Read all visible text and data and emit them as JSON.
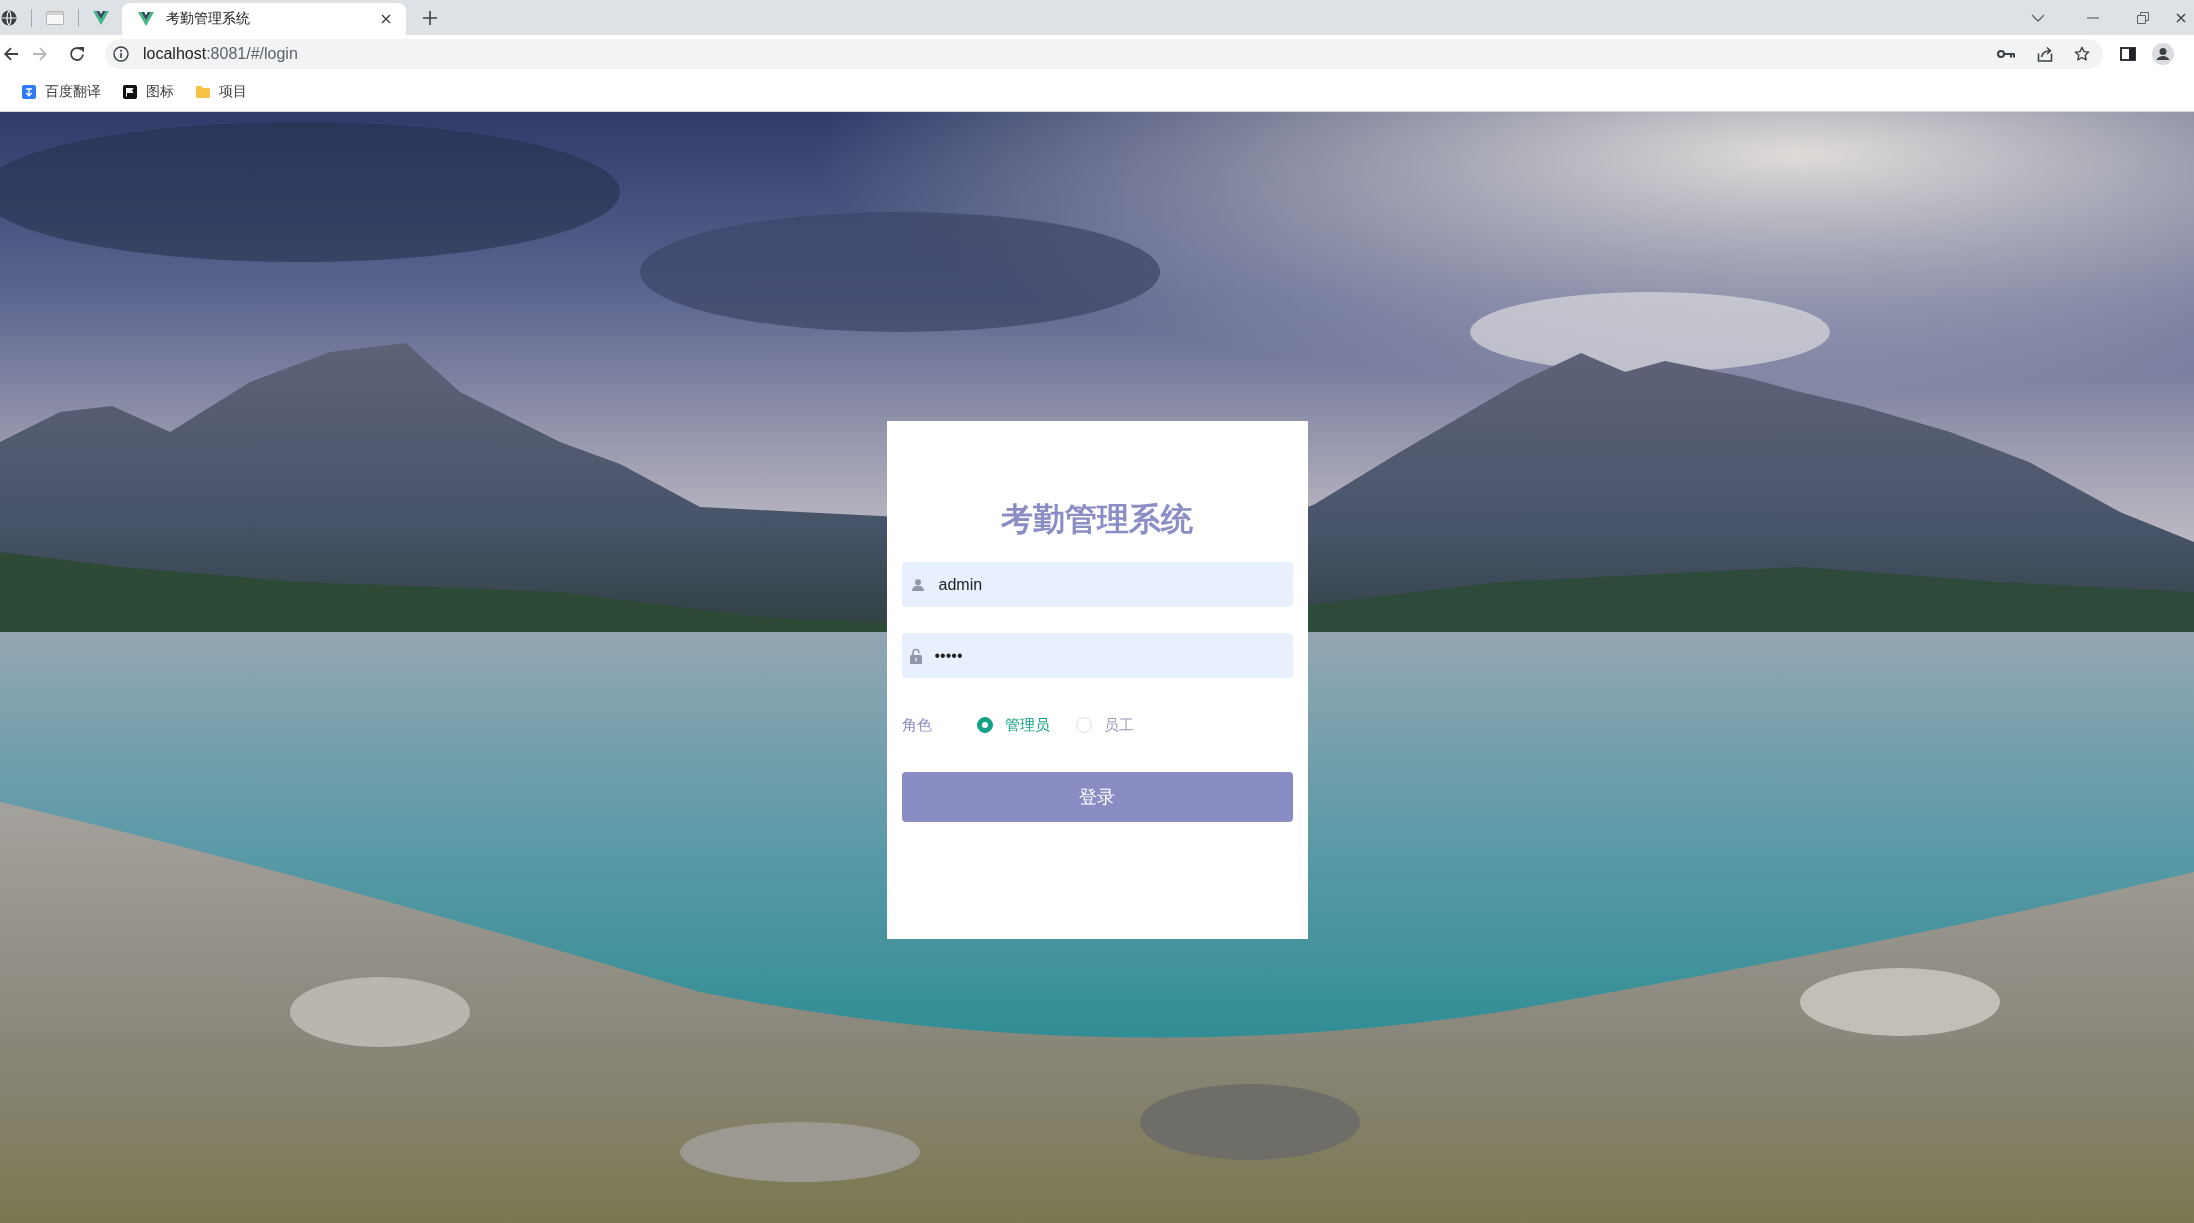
{
  "browser": {
    "tabs": [
      {
        "title": "考勤管理系统",
        "selected": true
      }
    ],
    "nav_buttons": [
      {
        "kind": "back",
        "disabled": false
      },
      {
        "kind": "forward",
        "disabled": true
      },
      {
        "kind": "reload",
        "disabled": false
      }
    ],
    "address": {
      "host": "localhost",
      "path": ":8081/#/login"
    },
    "bookmarks": [
      {
        "kind": "site",
        "label": "百度翻译"
      },
      {
        "kind": "site",
        "label": "图标"
      },
      {
        "kind": "folder",
        "label": "项目"
      }
    ]
  },
  "login": {
    "title": "考勤管理系统",
    "fields": [
      {
        "kind": "text",
        "value": "admin"
      },
      {
        "kind": "password",
        "value": "•••••"
      }
    ],
    "role": {
      "label": "角色",
      "options": [
        {
          "label": "管理员",
          "selected": true
        },
        {
          "label": "员工",
          "selected": false
        }
      ]
    },
    "submit": "登录"
  }
}
